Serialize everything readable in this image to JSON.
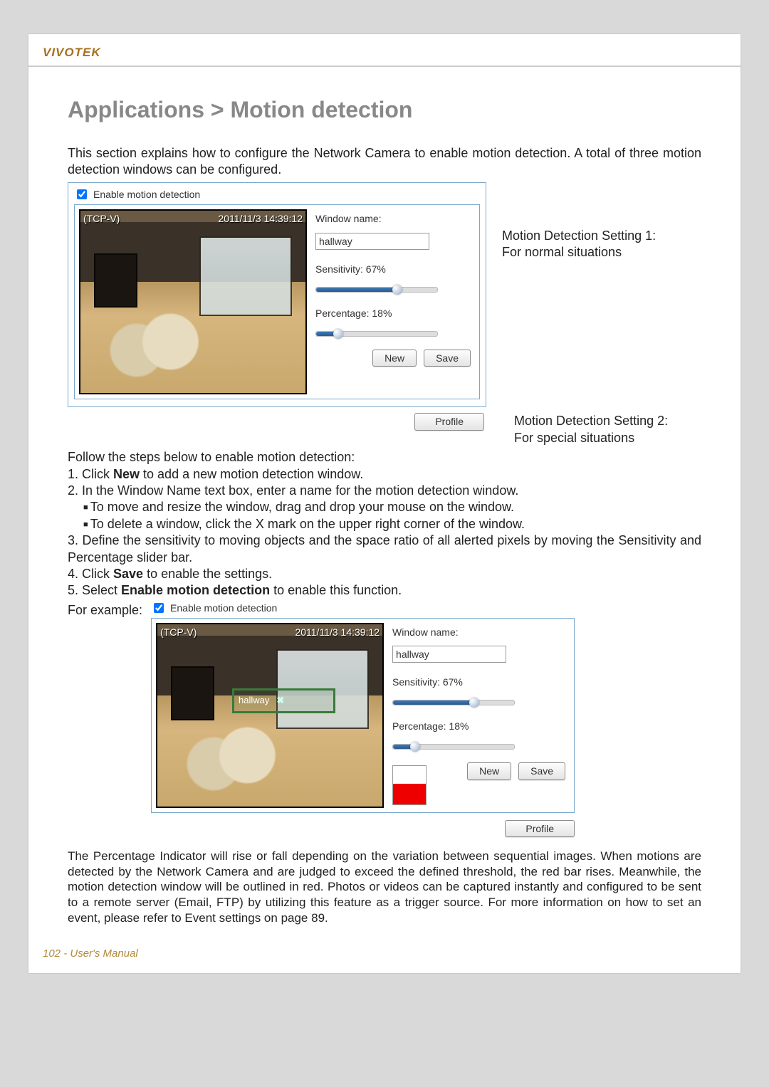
{
  "brand": "VIVOTEK",
  "title": "Applications > Motion detection",
  "intro": "This section explains how to configure the Network Camera to enable motion detection. A total of three motion detection windows can be configured.",
  "enable_label": "Enable motion detection",
  "panel1": {
    "video_name": "(TCP-V)",
    "timestamp": "2011/11/3 14:39:12",
    "window_name_label": "Window name:",
    "window_name_value": "hallway",
    "sens_label": "Sensitivity: 67%",
    "sens_pct": 67,
    "perc_label": "Percentage: 18%",
    "perc_pct": 18,
    "new_btn": "New",
    "save_btn": "Save",
    "profile_btn": "Profile"
  },
  "annot1_a": "Motion Detection Setting 1:",
  "annot1_b": "For normal situations",
  "annot2_a": "Motion Detection Setting 2:",
  "annot2_b": "For special situations",
  "steps_intro": "Follow the steps below to enable motion detection:",
  "steps": {
    "s1_a": "1. Click ",
    "s1_b": "New",
    "s1_c": " to add a new motion detection window.",
    "s2": "2. In the Window Name text box, enter a name for the motion detection window.",
    "s2_sub1": "To move and resize the window, drag and drop your mouse on the window.",
    "s2_sub2": "To delete a window, click the X mark on the upper right corner of the window.",
    "s3": "3. Define the sensitivity to moving objects and the space ratio of all alerted pixels by moving the Sensitivity and Percentage slider bar.",
    "s4_a": "4. Click ",
    "s4_b": "Save",
    "s4_c": " to enable the settings.",
    "s5_a": "5. Select ",
    "s5_b": "Enable motion detection",
    "s5_c": " to enable this function."
  },
  "example_label": "For example:",
  "panel2": {
    "md_window_label": "hallway",
    "indicator_pct": 55
  },
  "para2": "The Percentage Indicator will rise or fall depending on the variation between sequential images. When motions are detected by the Network Camera and are judged to exceed the defined threshold, the red bar rises. Meanwhile, the motion detection window will be outlined in red. Photos or videos can be captured instantly and configured to be sent to a remote server (Email, FTP) by utilizing this feature as a trigger source. For more information on how to set an event, please refer to Event settings on page 89.",
  "footer": "102 - User's Manual"
}
